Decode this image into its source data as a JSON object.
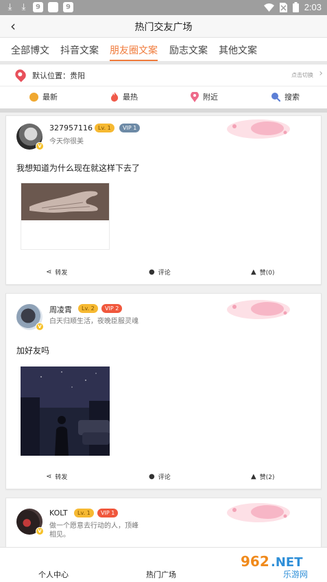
{
  "status_bar": {
    "time": "2:03"
  },
  "header": {
    "title": "热门交友广场"
  },
  "tabs": [
    {
      "label": "全部博文"
    },
    {
      "label": "抖音文案"
    },
    {
      "label": "朋友圈文案",
      "active": true
    },
    {
      "label": "励志文案"
    },
    {
      "label": "其他文案"
    }
  ],
  "location": {
    "label": "默认位置：贵阳",
    "switch_label": "点击切换"
  },
  "filters": [
    {
      "label": "最新",
      "icon": "clock-icon",
      "color": "#f0a830"
    },
    {
      "label": "最热",
      "icon": "flame-icon",
      "color": "#f05a4a"
    },
    {
      "label": "附近",
      "icon": "pin-icon",
      "color": "#ee6a8a"
    },
    {
      "label": "搜索",
      "icon": "search-icon",
      "color": "#5c7fd6"
    }
  ],
  "posts": [
    {
      "username": "327957116",
      "level": "Lv. 1",
      "vip": "VIP 1",
      "bio": "今天你很美",
      "content": "我想知道为什么现在就这样下去了",
      "actions": {
        "share": "转发",
        "comment": "评论",
        "like": "赞(0)"
      }
    },
    {
      "username": "周凌霄",
      "level": "Lv. 2",
      "vip": "VIP 2",
      "bio": "白天归顺生活，夜晚臣服灵魂",
      "content": "加好友吗",
      "actions": {
        "share": "转发",
        "comment": "评论",
        "like": "赞(2)"
      }
    },
    {
      "username": "KOLT",
      "level": "Lv. 1",
      "vip": "VIP 1",
      "bio": "做一个愿意去行动的人，顶峰相见。"
    }
  ],
  "bottom_nav": [
    {
      "label": "个人中心"
    },
    {
      "label": "热门广场"
    }
  ],
  "watermark": {
    "brand": "962.NET",
    "sub": "乐游网"
  }
}
